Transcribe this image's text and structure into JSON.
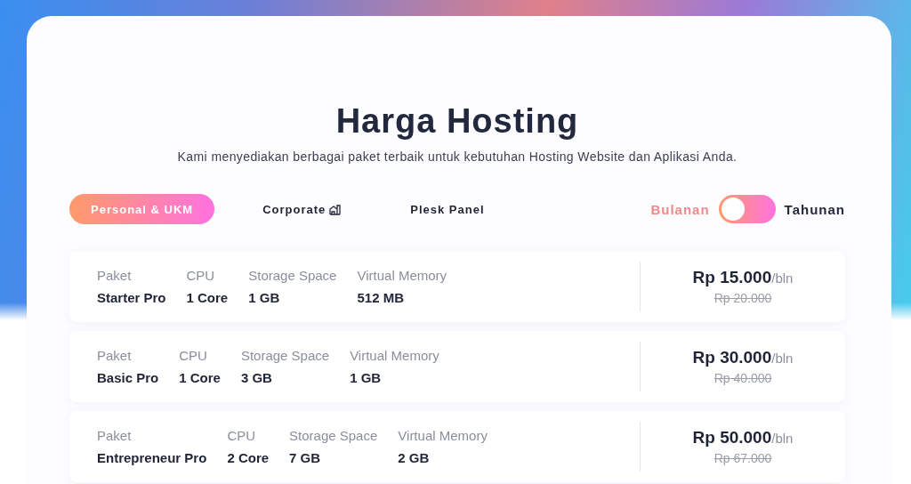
{
  "title": "Harga Hosting",
  "subtitle": "Kami menyediakan berbagai paket terbaik untuk kebutuhan Hosting Website dan Aplikasi Anda.",
  "tabs": [
    {
      "label": "Personal & UKM",
      "selected": true,
      "kind": "text"
    },
    {
      "label": "Corporate",
      "selected": false,
      "kind": "building"
    },
    {
      "label": "Plesk Panel",
      "selected": false,
      "kind": "text"
    }
  ],
  "billing_toggle": {
    "left_label": "Bulanan",
    "right_label": "Tahunan",
    "on": false
  },
  "plans": [
    {
      "fields": [
        {
          "label": "Paket",
          "value": "Starter Pro"
        },
        {
          "label": "CPU",
          "value": "1 Core"
        },
        {
          "label": "Storage Space",
          "value": "1 GB"
        },
        {
          "label": "Virtual Memory",
          "value": "512 MB"
        }
      ],
      "price": "Rp 15.000",
      "period": "/bln",
      "old_price": "Rp 20.000"
    },
    {
      "fields": [
        {
          "label": "Paket",
          "value": "Basic Pro"
        },
        {
          "label": "CPU",
          "value": "1 Core"
        },
        {
          "label": "Storage Space",
          "value": "3 GB"
        },
        {
          "label": "Virtual Memory",
          "value": "1 GB"
        }
      ],
      "price": "Rp 30.000",
      "period": "/bln",
      "old_price": "Rp 40.000"
    },
    {
      "fields": [
        {
          "label": "Paket",
          "value": "Entrepreneur Pro"
        },
        {
          "label": "CPU",
          "value": "2 Core"
        },
        {
          "label": "Storage Space",
          "value": "7 GB"
        },
        {
          "label": "Virtual Memory",
          "value": "2 GB"
        }
      ],
      "price": "Rp 50.000",
      "period": "/bln",
      "old_price": "Rp 67.000"
    }
  ]
}
